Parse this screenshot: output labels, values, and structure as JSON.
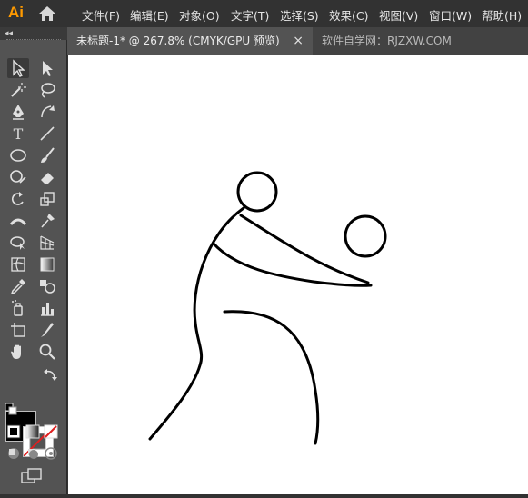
{
  "app": {
    "logo_text": "Ai",
    "logo_color": "#ff9a00"
  },
  "menu": {
    "items": [
      "文件(F)",
      "编辑(E)",
      "对象(O)",
      "文字(T)",
      "选择(S)",
      "效果(C)",
      "视图(V)",
      "窗口(W)",
      "帮助(H)"
    ]
  },
  "toolbox": {
    "collapse_label": "◂◂"
  },
  "tabs": {
    "document_title": "未标题-1* @ 267.8% (CMYK/GPU 预览)",
    "close_glyph": "×",
    "watermark": "软件自学网：RJZXW.COM"
  },
  "tools": [
    "selection-tool",
    "direct-selection-tool",
    "magic-wand-tool",
    "lasso-tool",
    "pen-tool",
    "curvature-tool",
    "type-tool",
    "line-segment-tool",
    "ellipse-tool",
    "paintbrush-tool",
    "shaper-tool",
    "eraser-tool",
    "rotate-tool",
    "scale-tool",
    "width-tool",
    "puppet-warp-tool",
    "shape-builder-tool",
    "perspective-grid-tool",
    "mesh-tool",
    "gradient-tool",
    "eyedropper-tool",
    "blend-tool",
    "symbol-sprayer-tool",
    "column-graph-tool",
    "artboard-tool",
    "slice-tool",
    "hand-tool",
    "zoom-tool"
  ],
  "colors": {
    "fill": "#000000",
    "stroke": "none",
    "accent": "#ff9a00",
    "canvas": "#ffffff",
    "chrome": "#323232",
    "panel": "#535353"
  }
}
